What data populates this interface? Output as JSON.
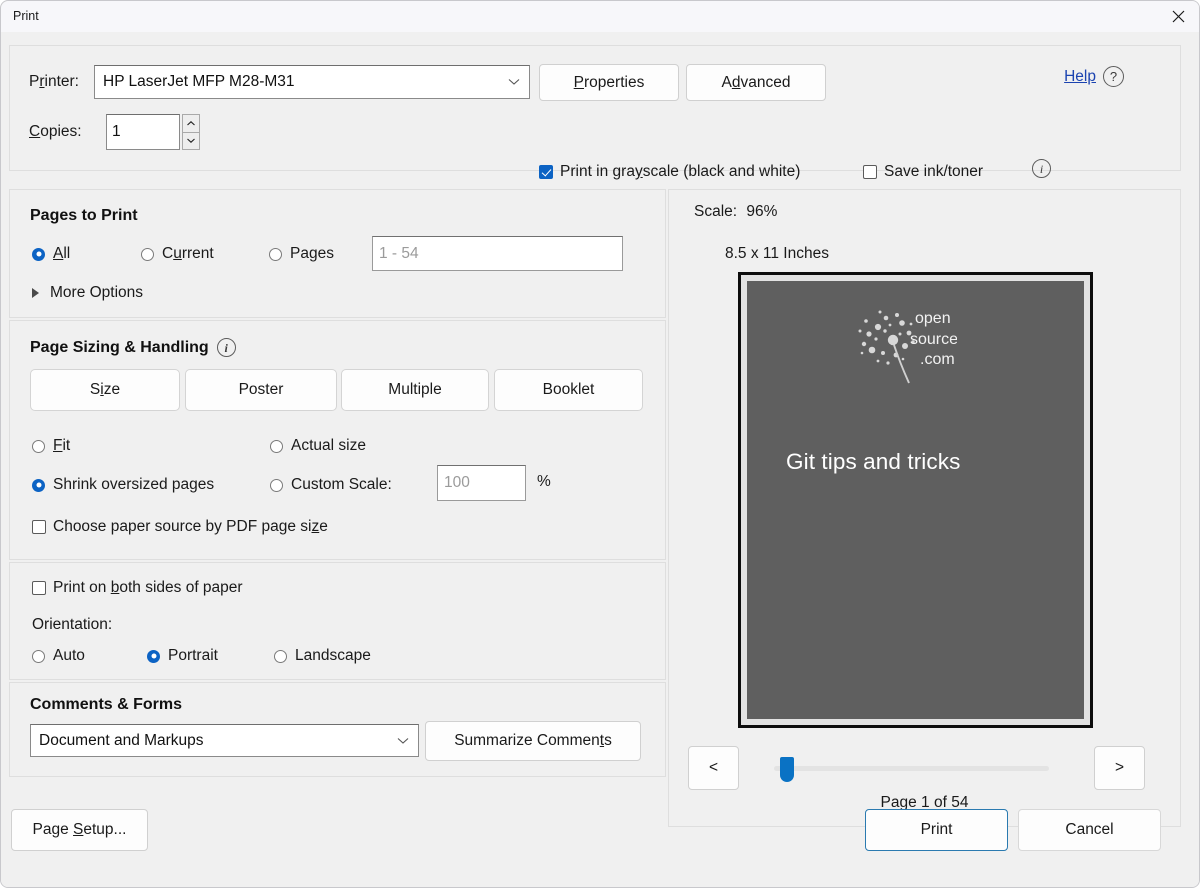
{
  "window": {
    "title": "Print",
    "close_icon": "close-icon"
  },
  "printer": {
    "label": "Printer:",
    "selected": "HP LaserJet MFP M28-M31",
    "properties_label": "Properties",
    "advanced_label": "Advanced",
    "help_label": "Help",
    "help_icon": "question-mark-icon",
    "copies_label": "Copies:",
    "copies_value": "1",
    "spinner_up_icon": "chevron-up-icon",
    "spinner_down_icon": "chevron-down-icon",
    "grayscale_label": "Print in grayscale (black and white)",
    "grayscale_checked": true,
    "saveink_label": "Save ink/toner",
    "saveink_checked": false,
    "toner_info_icon": "info-icon"
  },
  "pages_to_print": {
    "title": "Pages to Print",
    "options": [
      {
        "label": "All",
        "selected": true
      },
      {
        "label": "Current",
        "selected": false
      },
      {
        "label": "Pages",
        "selected": false
      }
    ],
    "range_placeholder": "1 - 54",
    "more_options_label": "More Options",
    "more_options_icon": "triangle-right-icon"
  },
  "page_sizing": {
    "title": "Page Sizing & Handling",
    "info_icon": "info-icon",
    "tabs": [
      {
        "label": "Size"
      },
      {
        "label": "Poster"
      },
      {
        "label": "Multiple"
      },
      {
        "label": "Booklet"
      }
    ],
    "fit_label": "Fit",
    "fit_selected": false,
    "actual_size_label": "Actual size",
    "actual_size_selected": false,
    "shrink_label": "Shrink oversized pages",
    "shrink_selected": true,
    "custom_scale_label": "Custom Scale:",
    "custom_scale_selected": false,
    "custom_scale_placeholder": "100",
    "percent_label": "%",
    "paper_source_label": "Choose paper source by PDF page size",
    "paper_source_checked": false
  },
  "duplex": {
    "both_sides_label": "Print on both sides of paper",
    "both_sides_checked": false,
    "orientation_label": "Orientation:",
    "orientations": [
      {
        "label": "Auto",
        "selected": false
      },
      {
        "label": "Portrait",
        "selected": true
      },
      {
        "label": "Landscape",
        "selected": false
      }
    ]
  },
  "comments_forms": {
    "title": "Comments & Forms",
    "selected": "Document and Markups",
    "summarize_label": "Summarize Comments"
  },
  "preview": {
    "scale_label": "Scale:",
    "scale_value": "96%",
    "paper_size": "8.5 x 11 Inches",
    "document_title": "Git tips and tricks",
    "logo_line1": "open",
    "logo_line2": "source",
    "logo_line3": ".com",
    "prev_label": "<",
    "next_label": ">",
    "page_indicator": "Page 1 of 54"
  },
  "footer": {
    "page_setup_label": "Page Setup...",
    "print_label": "Print",
    "cancel_label": "Cancel"
  },
  "colors": {
    "accent": "#0c63c4",
    "link": "#1b43b0",
    "slider": "#0a72c4",
    "page_bg": "#5f5f5f",
    "print_focus": "#2a7ab0"
  }
}
